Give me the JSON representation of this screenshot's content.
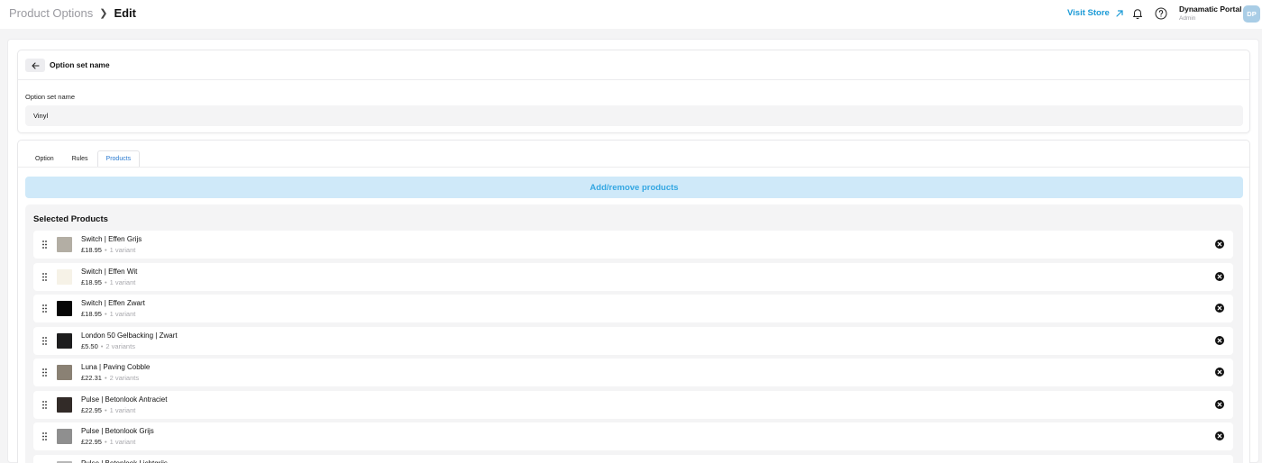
{
  "header": {
    "breadcrumb_parent": "Product Options",
    "breadcrumb_current": "Edit",
    "visit_store_label": "Visit Store",
    "user_name": "Dynamatic Portal",
    "user_role": "Admin",
    "avatar_initials": "DP"
  },
  "name_card": {
    "title": "Option set name",
    "field_label": "Option set name",
    "field_value": "Vinyl"
  },
  "tabs": [
    {
      "label": "Option",
      "active": false
    },
    {
      "label": "Rules",
      "active": false
    },
    {
      "label": "Products",
      "active": true
    }
  ],
  "add_remove_label": "Add/remove products",
  "selected_products": {
    "title": "Selected Products",
    "items": [
      {
        "name": "Switch | Effen Grijs",
        "price": "£18.95",
        "variants": "1 variant",
        "swatch": "#b3aea4"
      },
      {
        "name": "Switch | Effen Wit",
        "price": "£18.95",
        "variants": "1 variant",
        "swatch": "#f6f2e7"
      },
      {
        "name": "Switch | Effen Zwart",
        "price": "£18.95",
        "variants": "1 variant",
        "swatch": "#070707"
      },
      {
        "name": "London 50 Gelbacking | Zwart",
        "price": "£5.50",
        "variants": "2 variants",
        "swatch": "#1d1d1e"
      },
      {
        "name": "Luna | Paving Cobble",
        "price": "£22.31",
        "variants": "2 variants",
        "swatch": "#8a8174"
      },
      {
        "name": "Pulse | Betonlook Antraciet",
        "price": "£22.95",
        "variants": "1 variant",
        "swatch": "#322b28"
      },
      {
        "name": "Pulse | Betonlook Grijs",
        "price": "£22.95",
        "variants": "1 variant",
        "swatch": "#8f8f8f"
      },
      {
        "name": "Pulse | Betonlook Lichtgrijs",
        "price": "",
        "variants": "",
        "swatch": "#b7b7b7"
      }
    ]
  },
  "colors": {
    "accent": "#1b9ad6",
    "button_bg": "#cfe9f9",
    "tab_active": "#2a7ad0",
    "avatar_bg": "#a9cde6"
  }
}
